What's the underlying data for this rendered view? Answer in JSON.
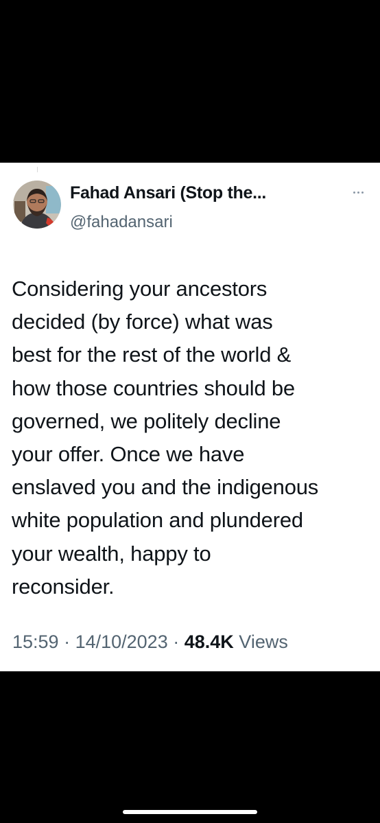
{
  "tweet": {
    "author": {
      "name": "Fahad Ansari (Stop the...",
      "handle": "@fahadansari",
      "avatar_icon": "profile-photo"
    },
    "more_icon": "more-options-icon",
    "body_lines": [
      "Considering your ancestors",
      "decided (by force) what was",
      "best for the rest of the world &",
      "how those countries should be",
      "governed, we politely decline",
      "your offer. Once we have",
      "enslaved you and the indigenous",
      "white population and plundered",
      "your wealth, happy to",
      "reconsider."
    ],
    "meta": {
      "time": "15:59",
      "separator": " · ",
      "date": "14/10/2023",
      "views_count": "48.4K",
      "views_label": "Views"
    }
  },
  "colors": {
    "background": "#000000",
    "card": "#ffffff",
    "text_primary": "#0f1419",
    "text_secondary": "#536471"
  }
}
